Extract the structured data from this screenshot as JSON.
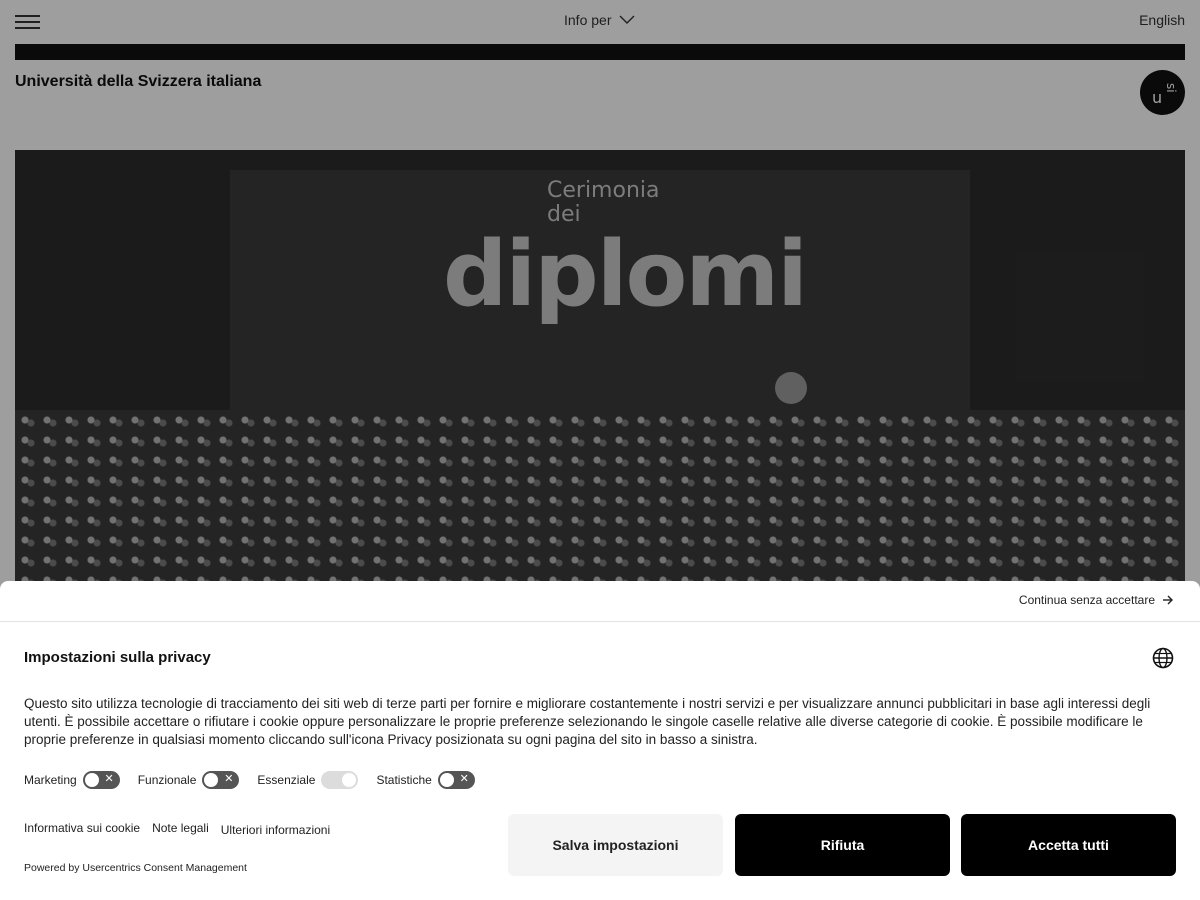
{
  "header": {
    "info_per": "Info per",
    "language": "English"
  },
  "university": {
    "name": "Università della Svizzera italiana"
  },
  "hero": {
    "line1": "Cerimonia",
    "line2": "dei",
    "line3": "diplomi"
  },
  "consent": {
    "continue_label": "Continua senza accettare",
    "title": "Impostazioni sulla privacy",
    "description": "Questo sito utilizza tecnologie di tracciamento dei siti web di terze parti per fornire e migliorare costantemente i nostri servizi e per visualizzare annunci pubblicitari in base agli interessi degli utenti. È possibile accettare o rifiutare i cookie oppure personalizzare le proprie preferenze selezionando le singole caselle relative alle diverse categorie di cookie.  È possibile modificare le proprie preferenze in qualsiasi momento cliccando sull'icona Privacy posizionata su ogni pagina del sito in basso a sinistra.",
    "toggles": [
      {
        "label": "Marketing",
        "state": "off"
      },
      {
        "label": "Funzionale",
        "state": "off"
      },
      {
        "label": "Essenziale",
        "state": "on-disabled"
      },
      {
        "label": "Statistiche",
        "state": "off"
      }
    ],
    "links": [
      "Informativa sui cookie",
      "Note legali",
      "Ulteriori informazioni"
    ],
    "powered_by": "Powered by Usercentrics Consent Management",
    "buttons": {
      "save": "Salva impostazioni",
      "reject": "Rifiuta",
      "accept": "Accetta tutti"
    }
  }
}
